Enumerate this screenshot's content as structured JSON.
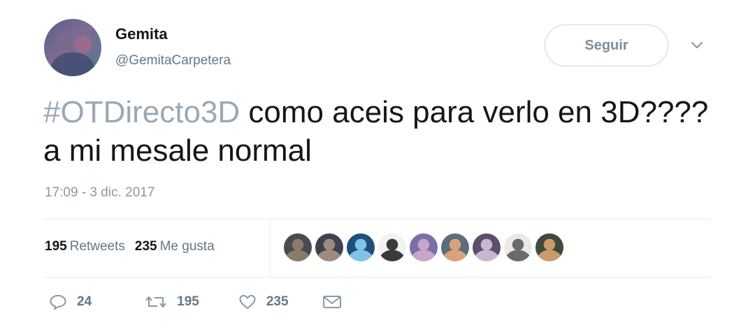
{
  "user": {
    "display_name": "Gemita",
    "handle": "@GemitaCarpetera",
    "avatar_icon": "user-avatar"
  },
  "follow_label": "Seguir",
  "tweet": {
    "hashtag": "#OTDirecto3D",
    "text": " como aceis para verlo en 3D???? a mi mesale normal",
    "timestamp": "17:09 - 3 dic. 2017"
  },
  "stats": {
    "retweets_count": "195",
    "retweets_label": "Retweets",
    "likes_count": "235",
    "likes_label": "Me gusta"
  },
  "likers": [
    {
      "color": "#4a4a52",
      "accent": "#8a7a6a"
    },
    {
      "color": "#3d4250",
      "accent": "#a08a80"
    },
    {
      "color": "#1f4f7a",
      "accent": "#7fc3e8"
    },
    {
      "color": "#f2f2f2",
      "accent": "#3a3a3a"
    },
    {
      "color": "#7b6fa8",
      "accent": "#c7a7c9"
    },
    {
      "color": "#5a6e7c",
      "accent": "#d9a27a"
    },
    {
      "color": "#5b4e6e",
      "accent": "#c9b7cf"
    },
    {
      "color": "#e9e9e9",
      "accent": "#6a6a6a"
    },
    {
      "color": "#3e4a3c",
      "accent": "#c99a6a"
    }
  ],
  "actions": {
    "reply_count": "24",
    "retweet_count": "195",
    "like_count": "235"
  },
  "colors": {
    "text": "#14171a",
    "secondary": "#657786",
    "hashtag": "#9aa8b5",
    "border": "#e6ecf0"
  }
}
